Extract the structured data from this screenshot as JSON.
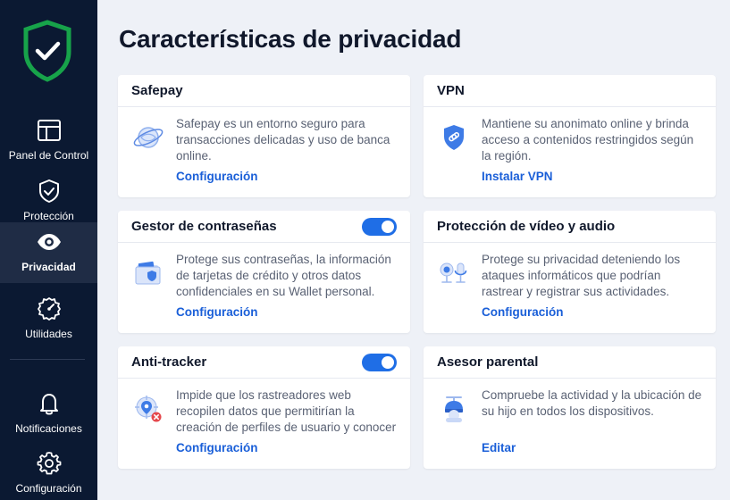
{
  "sidebar": {
    "items": [
      {
        "label": "Panel de Control",
        "icon": "dashboard-icon"
      },
      {
        "label": "Protección",
        "icon": "shield-check-icon"
      },
      {
        "label": "Privacidad",
        "icon": "eye-icon",
        "active": true
      },
      {
        "label": "Utilidades",
        "icon": "speed-gear-icon"
      },
      {
        "label": "Notificaciones",
        "icon": "bell-icon"
      },
      {
        "label": "Configuración",
        "icon": "gear-icon"
      }
    ]
  },
  "page": {
    "title": "Características de privacidad"
  },
  "cards": {
    "safepay": {
      "title": "Safepay",
      "icon": "safepay-globe-icon",
      "description": "Safepay es un entorno seguro para transacciones delicadas y uso de banca online.",
      "link": "Configuración"
    },
    "vpn": {
      "title": "VPN",
      "icon": "vpn-shield-icon",
      "description": "Mantiene su anonimato online y brinda acceso a contenidos restringidos según la región.",
      "link": "Instalar VPN"
    },
    "passwords": {
      "title": "Gestor de contraseñas",
      "icon": "wallet-icon",
      "description": "Protege sus contraseñas, la información de tarjetas de crédito y otros datos confidenciales en su Wallet personal.",
      "link": "Configuración",
      "toggle_on": true
    },
    "video_audio": {
      "title": "Protección de vídeo y audio",
      "icon": "webcam-microphone-icon",
      "description": "Protege su privacidad deteniendo los ataques informáticos que podrían rastrear y registrar sus actividades.",
      "link": "Configuración"
    },
    "antitracker": {
      "title": "Anti-tracker",
      "icon": "tracker-blocked-icon",
      "description": "Impide que los rastreadores web recopilen datos que permitirían la creación de perfiles de usuario y conocer",
      "link": "Configuración",
      "toggle_on": true
    },
    "parental": {
      "title": "Asesor parental",
      "icon": "child-icon",
      "description": "Compruebe la actividad y la ubicación de su hijo en todos los dispositivos.",
      "link": "Editar"
    }
  },
  "colors": {
    "sidebar_bg": "#0b1932",
    "accent": "#1a5fd8",
    "brand_green": "#17a34a",
    "page_bg": "#eef1f7"
  }
}
